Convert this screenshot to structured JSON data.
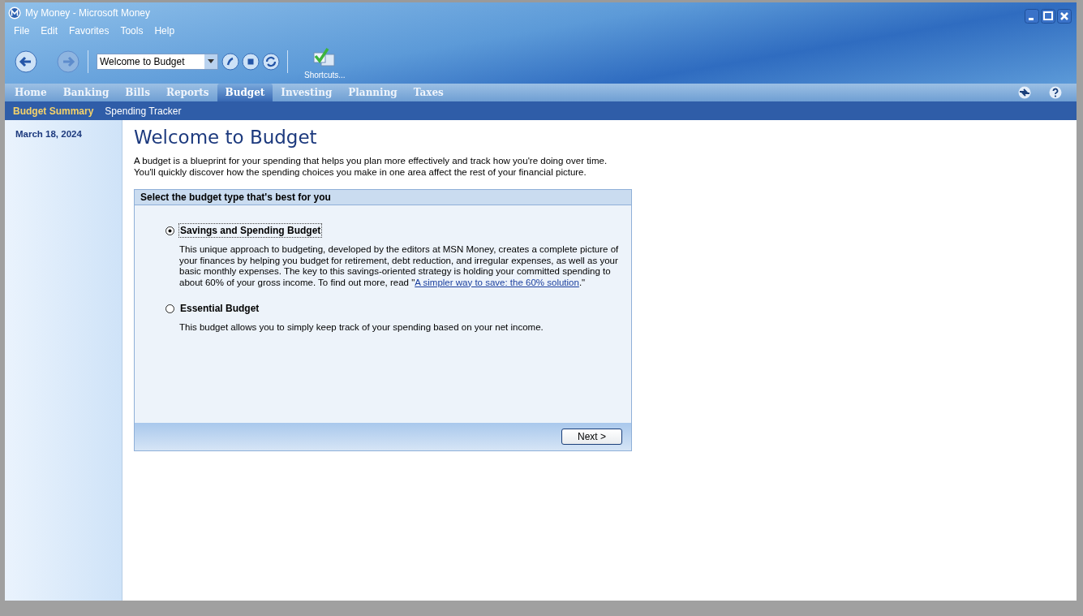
{
  "window": {
    "title": "My Money - Microsoft Money"
  },
  "menu": [
    "File",
    "Edit",
    "Favorites",
    "Tools",
    "Help"
  ],
  "toolbar": {
    "address": "Welcome to Budget",
    "shortcuts": "Shortcuts..."
  },
  "tabs": [
    {
      "label": "Home",
      "selected": false
    },
    {
      "label": "Banking",
      "selected": false
    },
    {
      "label": "Bills",
      "selected": false
    },
    {
      "label": "Reports",
      "selected": false
    },
    {
      "label": "Budget",
      "selected": true
    },
    {
      "label": "Investing",
      "selected": false
    },
    {
      "label": "Planning",
      "selected": false
    },
    {
      "label": "Taxes",
      "selected": false
    }
  ],
  "subtabs": [
    {
      "label": "Budget Summary",
      "selected": true
    },
    {
      "label": "Spending Tracker",
      "selected": false
    }
  ],
  "sidebar": {
    "date": "March 18, 2024"
  },
  "page": {
    "title": "Welcome to Budget",
    "intro": "A budget is a blueprint for your spending that helps you plan more effectively and track how you're doing over time. You'll quickly discover how the spending choices you make in one area affect the rest of your financial picture.",
    "panel_heading": "Select the budget type that's best for you",
    "options": [
      {
        "label": "Savings and Spending Budget",
        "selected": true,
        "description": "This unique approach to budgeting, developed by the editors at MSN Money, creates a complete picture of your finances by helping you budget for retirement, debt reduction, and irregular expenses, as well as your basic monthly expenses. The key to this savings-oriented strategy is holding your committed spending to about 60% of your gross income. To find out more, read \"",
        "link": "A simpler way to save: the 60% solution",
        "description_end": ".\""
      },
      {
        "label": "Essential Budget",
        "selected": false,
        "description": "This budget allows you to simply keep track of your spending based on your net income."
      }
    ],
    "button": "Next >"
  }
}
